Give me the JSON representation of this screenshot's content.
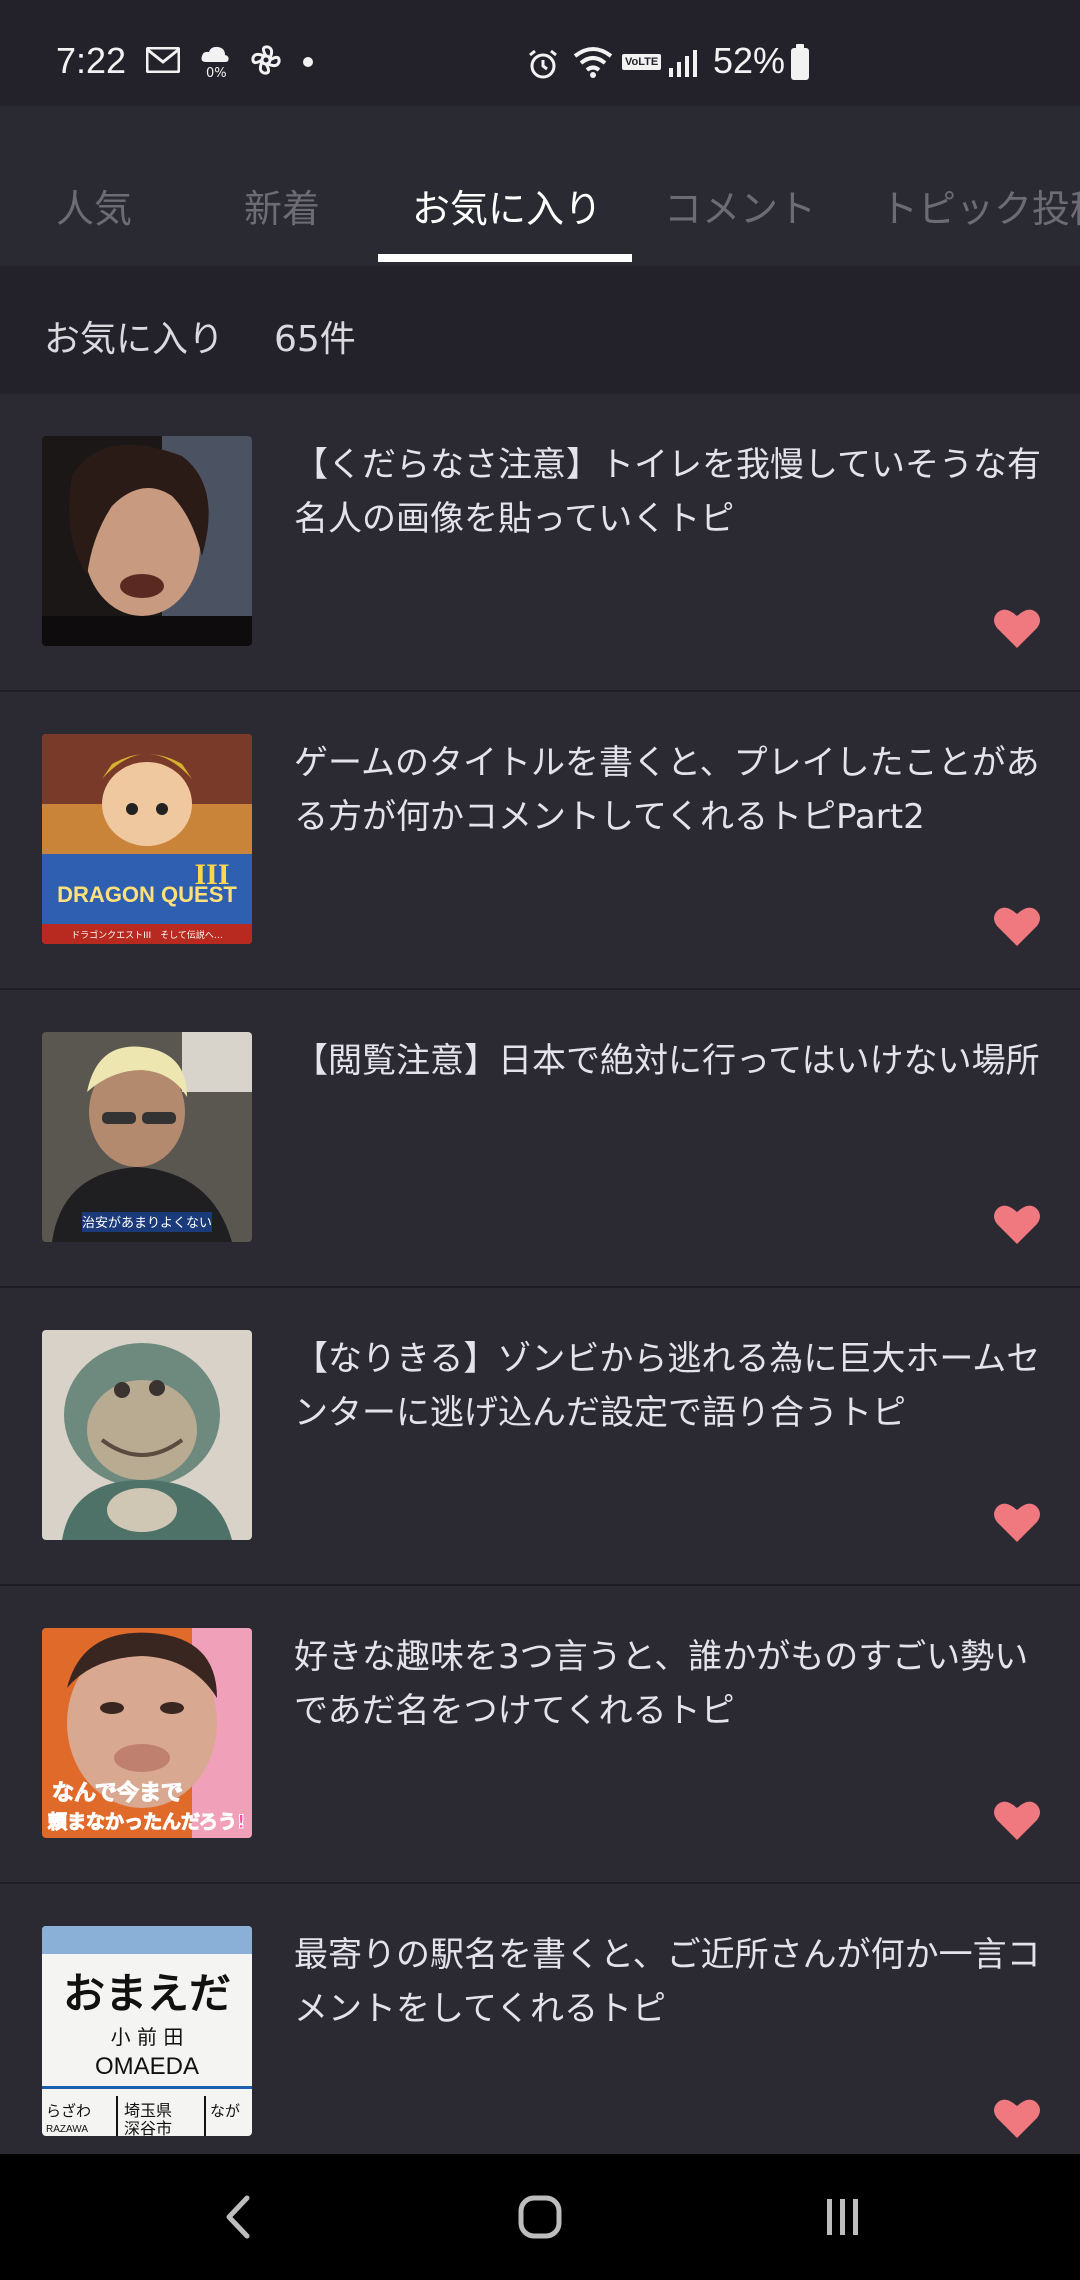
{
  "status_bar": {
    "time": "7:22",
    "battery_percent": "52%",
    "left_icons": [
      "mail-icon",
      "weather-icon",
      "fan-icon",
      "dot-icon"
    ],
    "right_icons": [
      "alarm-icon",
      "wifi-icon",
      "volte-icon",
      "signal-icon",
      "battery-icon"
    ],
    "weather_small_text": "0%",
    "volte_text": "VoLTE"
  },
  "tabs": {
    "items": [
      {
        "label": "人気",
        "active": false
      },
      {
        "label": "新着",
        "active": false
      },
      {
        "label": "お気に入り",
        "active": true
      },
      {
        "label": "コメント",
        "active": false
      },
      {
        "label": "トピック投稿",
        "active": false
      }
    ]
  },
  "favorites_header": {
    "label": "お気に入り",
    "count": "65件"
  },
  "items": [
    {
      "title": "【くだらなさ注意】トイレを我慢していそうな有名人の画像を貼っていくトピ",
      "favorited": true
    },
    {
      "title": "ゲームのタイトルを書くと、プレイしたことがある方が何かコメントしてくれるトピPart2",
      "favorited": true
    },
    {
      "title": "【閲覧注意】日本で絶対に行ってはいけない場所",
      "favorited": true
    },
    {
      "title": "【なりきる】ゾンビから逃れる為に巨大ホームセンターに逃げ込んだ設定で語り合うトピ",
      "favorited": true
    },
    {
      "title": "好きな趣味を3つ言うと、誰かがものすごい勢いであだ名をつけてくれるトピ",
      "favorited": true
    },
    {
      "title": "最寄りの駅名を書くと、ご近所さんが何か一言コメントをしてくれるトピ",
      "favorited": true
    }
  ],
  "thumb_texts": {
    "dq_logo": "DRAGON QUEST",
    "dq_roman": "III",
    "dq_sub": "ドラゴンクエストIII　そして伝説へ…",
    "caption_3": "治安があまりよくない",
    "caption_5_line1": "なんで今まで",
    "caption_5_line2": "頼まなかったんだろう!",
    "station_kana": "おまえだ",
    "station_kanji": "小 前 田",
    "station_roman": "OMAEDA",
    "station_prev": "らざわ",
    "station_prev_roman": "RAZAWA",
    "station_pref": "埼玉県",
    "station_city": "深谷市",
    "station_next": "なが"
  },
  "colors": {
    "accent_heart": "#f0787f",
    "background": "#23222b",
    "card": "#2b2a33",
    "nav_bar": "#000000"
  },
  "nav": {
    "buttons": [
      "back-icon",
      "home-icon",
      "recents-icon"
    ]
  }
}
